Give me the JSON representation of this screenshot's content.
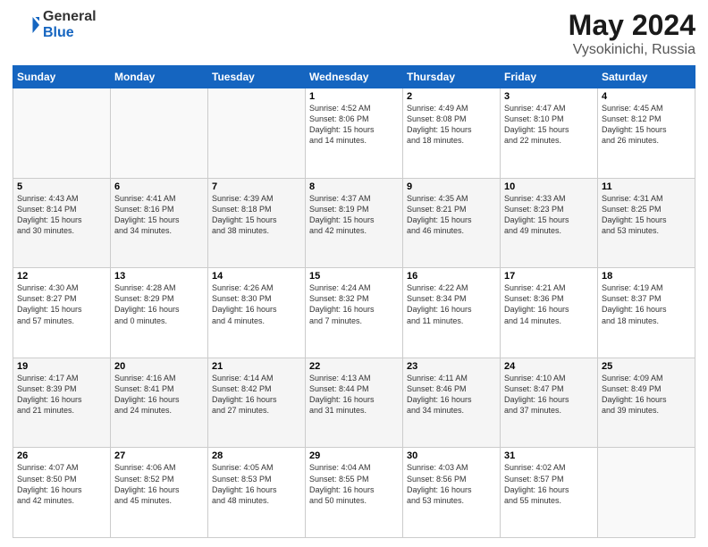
{
  "header": {
    "logo_general": "General",
    "logo_blue": "Blue",
    "title": "May 2024",
    "location": "Vysokinichi, Russia"
  },
  "days_of_week": [
    "Sunday",
    "Monday",
    "Tuesday",
    "Wednesday",
    "Thursday",
    "Friday",
    "Saturday"
  ],
  "weeks": [
    [
      {
        "num": "",
        "info": ""
      },
      {
        "num": "",
        "info": ""
      },
      {
        "num": "",
        "info": ""
      },
      {
        "num": "1",
        "info": "Sunrise: 4:52 AM\nSunset: 8:06 PM\nDaylight: 15 hours\nand 14 minutes."
      },
      {
        "num": "2",
        "info": "Sunrise: 4:49 AM\nSunset: 8:08 PM\nDaylight: 15 hours\nand 18 minutes."
      },
      {
        "num": "3",
        "info": "Sunrise: 4:47 AM\nSunset: 8:10 PM\nDaylight: 15 hours\nand 22 minutes."
      },
      {
        "num": "4",
        "info": "Sunrise: 4:45 AM\nSunset: 8:12 PM\nDaylight: 15 hours\nand 26 minutes."
      }
    ],
    [
      {
        "num": "5",
        "info": "Sunrise: 4:43 AM\nSunset: 8:14 PM\nDaylight: 15 hours\nand 30 minutes."
      },
      {
        "num": "6",
        "info": "Sunrise: 4:41 AM\nSunset: 8:16 PM\nDaylight: 15 hours\nand 34 minutes."
      },
      {
        "num": "7",
        "info": "Sunrise: 4:39 AM\nSunset: 8:18 PM\nDaylight: 15 hours\nand 38 minutes."
      },
      {
        "num": "8",
        "info": "Sunrise: 4:37 AM\nSunset: 8:19 PM\nDaylight: 15 hours\nand 42 minutes."
      },
      {
        "num": "9",
        "info": "Sunrise: 4:35 AM\nSunset: 8:21 PM\nDaylight: 15 hours\nand 46 minutes."
      },
      {
        "num": "10",
        "info": "Sunrise: 4:33 AM\nSunset: 8:23 PM\nDaylight: 15 hours\nand 49 minutes."
      },
      {
        "num": "11",
        "info": "Sunrise: 4:31 AM\nSunset: 8:25 PM\nDaylight: 15 hours\nand 53 minutes."
      }
    ],
    [
      {
        "num": "12",
        "info": "Sunrise: 4:30 AM\nSunset: 8:27 PM\nDaylight: 15 hours\nand 57 minutes."
      },
      {
        "num": "13",
        "info": "Sunrise: 4:28 AM\nSunset: 8:29 PM\nDaylight: 16 hours\nand 0 minutes."
      },
      {
        "num": "14",
        "info": "Sunrise: 4:26 AM\nSunset: 8:30 PM\nDaylight: 16 hours\nand 4 minutes."
      },
      {
        "num": "15",
        "info": "Sunrise: 4:24 AM\nSunset: 8:32 PM\nDaylight: 16 hours\nand 7 minutes."
      },
      {
        "num": "16",
        "info": "Sunrise: 4:22 AM\nSunset: 8:34 PM\nDaylight: 16 hours\nand 11 minutes."
      },
      {
        "num": "17",
        "info": "Sunrise: 4:21 AM\nSunset: 8:36 PM\nDaylight: 16 hours\nand 14 minutes."
      },
      {
        "num": "18",
        "info": "Sunrise: 4:19 AM\nSunset: 8:37 PM\nDaylight: 16 hours\nand 18 minutes."
      }
    ],
    [
      {
        "num": "19",
        "info": "Sunrise: 4:17 AM\nSunset: 8:39 PM\nDaylight: 16 hours\nand 21 minutes."
      },
      {
        "num": "20",
        "info": "Sunrise: 4:16 AM\nSunset: 8:41 PM\nDaylight: 16 hours\nand 24 minutes."
      },
      {
        "num": "21",
        "info": "Sunrise: 4:14 AM\nSunset: 8:42 PM\nDaylight: 16 hours\nand 27 minutes."
      },
      {
        "num": "22",
        "info": "Sunrise: 4:13 AM\nSunset: 8:44 PM\nDaylight: 16 hours\nand 31 minutes."
      },
      {
        "num": "23",
        "info": "Sunrise: 4:11 AM\nSunset: 8:46 PM\nDaylight: 16 hours\nand 34 minutes."
      },
      {
        "num": "24",
        "info": "Sunrise: 4:10 AM\nSunset: 8:47 PM\nDaylight: 16 hours\nand 37 minutes."
      },
      {
        "num": "25",
        "info": "Sunrise: 4:09 AM\nSunset: 8:49 PM\nDaylight: 16 hours\nand 39 minutes."
      }
    ],
    [
      {
        "num": "26",
        "info": "Sunrise: 4:07 AM\nSunset: 8:50 PM\nDaylight: 16 hours\nand 42 minutes."
      },
      {
        "num": "27",
        "info": "Sunrise: 4:06 AM\nSunset: 8:52 PM\nDaylight: 16 hours\nand 45 minutes."
      },
      {
        "num": "28",
        "info": "Sunrise: 4:05 AM\nSunset: 8:53 PM\nDaylight: 16 hours\nand 48 minutes."
      },
      {
        "num": "29",
        "info": "Sunrise: 4:04 AM\nSunset: 8:55 PM\nDaylight: 16 hours\nand 50 minutes."
      },
      {
        "num": "30",
        "info": "Sunrise: 4:03 AM\nSunset: 8:56 PM\nDaylight: 16 hours\nand 53 minutes."
      },
      {
        "num": "31",
        "info": "Sunrise: 4:02 AM\nSunset: 8:57 PM\nDaylight: 16 hours\nand 55 minutes."
      },
      {
        "num": "",
        "info": ""
      }
    ]
  ]
}
